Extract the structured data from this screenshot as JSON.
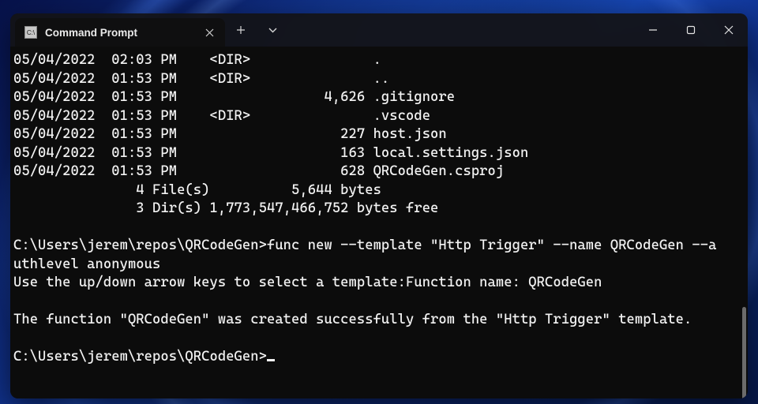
{
  "window": {
    "tab_title": "Command Prompt"
  },
  "terminal": {
    "prompt": "C:\\Users\\jerem\\repos\\QRCodeGen>",
    "listing": [
      {
        "date": "05/04/2022",
        "time": "02:03 PM",
        "dir": true,
        "size": "",
        "name": "."
      },
      {
        "date": "05/04/2022",
        "time": "01:53 PM",
        "dir": true,
        "size": "",
        "name": ".."
      },
      {
        "date": "05/04/2022",
        "time": "01:53 PM",
        "dir": false,
        "size": "4,626",
        "name": ".gitignore"
      },
      {
        "date": "05/04/2022",
        "time": "01:53 PM",
        "dir": true,
        "size": "",
        "name": ".vscode"
      },
      {
        "date": "05/04/2022",
        "time": "01:53 PM",
        "dir": false,
        "size": "227",
        "name": "host.json"
      },
      {
        "date": "05/04/2022",
        "time": "01:53 PM",
        "dir": false,
        "size": "163",
        "name": "local.settings.json"
      },
      {
        "date": "05/04/2022",
        "time": "01:53 PM",
        "dir": false,
        "size": "628",
        "name": "QRCodeGen.csproj"
      }
    ],
    "summary": {
      "file_count": "4",
      "file_bytes": "5,644",
      "dir_count": "3",
      "dir_bytes_free": "1,773,547,466,752"
    },
    "command": "func new --template \"Http Trigger\" --name QRCodeGen --authlevel anonymous",
    "response1": "Use the up/down arrow keys to select a template:Function name: QRCodeGen",
    "response2": "The function \"QRCodeGen\" was created successfully from the \"Http Trigger\" template."
  }
}
